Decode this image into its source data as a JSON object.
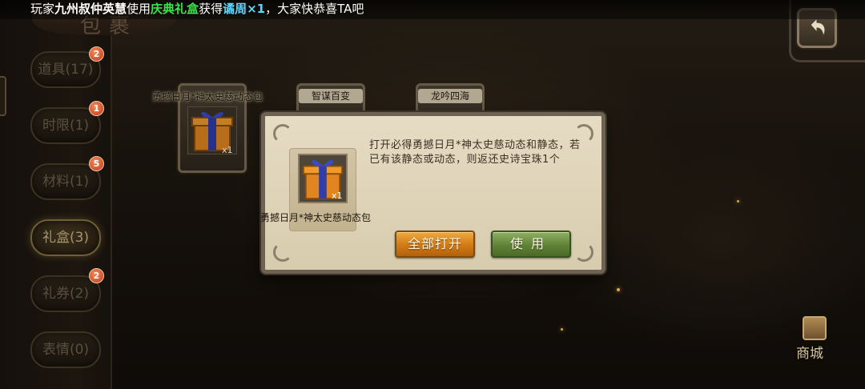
{
  "ticker": {
    "prefix": "玩家",
    "player": "九州叔仲英慧",
    "use_text": "使用",
    "item": "庆典礼盒",
    "got_text": "获得",
    "reward": "谲周×1",
    "suffix": "，大家快恭喜TA吧"
  },
  "page_title": "包裹",
  "tabs": [
    {
      "label": "道具",
      "count": "(17)",
      "badge": "2",
      "active": false
    },
    {
      "label": "时限",
      "count": "(1)",
      "badge": "1",
      "active": false
    },
    {
      "label": "材料",
      "count": "(1)",
      "badge": "5",
      "active": false
    },
    {
      "label": "礼盒",
      "count": "(3)",
      "badge": "",
      "active": true
    },
    {
      "label": "礼券",
      "count": "(2)",
      "badge": "2",
      "active": false
    },
    {
      "label": "表情",
      "count": "(0)",
      "badge": "",
      "active": false
    }
  ],
  "inventory": [
    {
      "name": "勇撼日月*神太史慈动态包",
      "qty": "x1"
    },
    {
      "name": "智谋百变",
      "qty": ""
    },
    {
      "name": "龙吟四海",
      "qty": ""
    }
  ],
  "dialog": {
    "item_name": "勇撼日月*神太史慈动态包",
    "item_qty": "x1",
    "description": "打开必得勇撼日月*神太史慈动态和静态，若已有该静态或动态，则返还史诗宝珠1个",
    "open_all_label": "全部打开",
    "use_label": "使用"
  },
  "shop_label": "商城",
  "colors": {
    "ticker_green": "#39e34a",
    "ticker_cyan": "#5ad7ff",
    "open_all_orange": "#d07a16",
    "use_green": "#5f8236",
    "badge_red": "#c0391b"
  },
  "icons": {
    "back": "undo-arrow-icon",
    "shop": "treasure-chest-icon",
    "gift": "gift-box-icon"
  }
}
